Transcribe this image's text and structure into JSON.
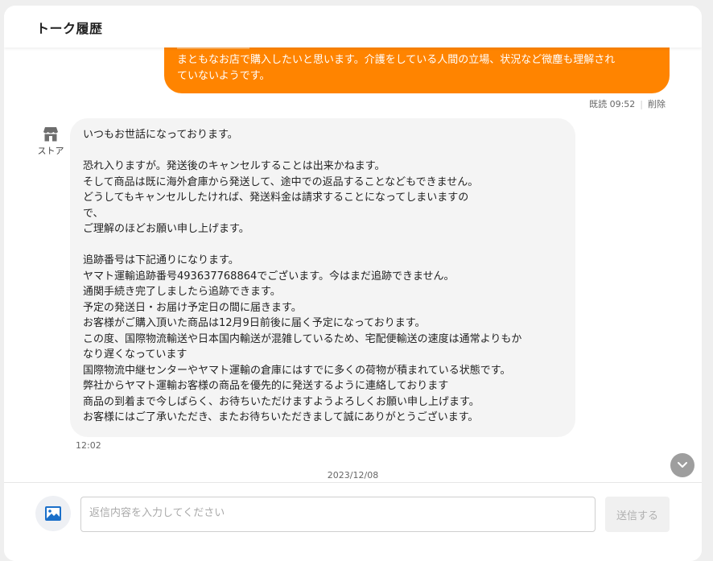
{
  "header": {
    "title": "トーク履歴"
  },
  "user_message": {
    "lines": [
      "まともなお店で購入したいと思います。介護をしている人間の立場、状況など微塵も理解され",
      "ていないようです。"
    ],
    "read_label": "既読 09:52",
    "delete_label": "削除"
  },
  "store_message": {
    "sender_label": "ストア",
    "lines": [
      "いつもお世話になっております。",
      "",
      "恐れ入りますが。発送後のキャンセルすることは出来かねます。",
      "そして商品は既に海外倉庫から発送して、途中での返品することなどもできません。",
      "どうしてもキャンセルしたければ、発送料金は請求することになってしまいますの",
      "で、",
      "ご理解のほどお願い申し上げます。",
      "",
      "追跡番号は下記通りになります。",
      "ヤマト運輸追跡番号493637768864でございます。今はまだ追跡できません。",
      "通関手続き完了しましたら追跡できます。",
      "予定の発送日・お届け予定日の間に届きます。",
      "お客様がご購入頂いた商品は12月9日前後に届く予定になっております。",
      "この度、国際物流輸送や日本国内輸送が混雑しているため、宅配便輸送の速度は通常よりもか",
      "なり遅くなっています",
      "国際物流中継センターやヤマト運輸の倉庫にはすでに多くの荷物が積まれている状態です。",
      "弊社からヤマト運輸お客様の商品を優先的に発送するように連絡しております",
      "商品の到着まで今しばらく、お待ちいただけますようよろしくお願い申し上げます。",
      "お客様にはご了承いただき、またお待ちいただきまして誠にありがとうございます。"
    ],
    "time": "12:02"
  },
  "date_divider": "2023/12/08",
  "composer": {
    "placeholder": "返信内容を入力してください",
    "send_label": "送信する"
  },
  "colors": {
    "accent_orange": "#ff8400",
    "store_bubble": "#f4f4f4",
    "image_icon_blue": "#1a6fc9"
  }
}
